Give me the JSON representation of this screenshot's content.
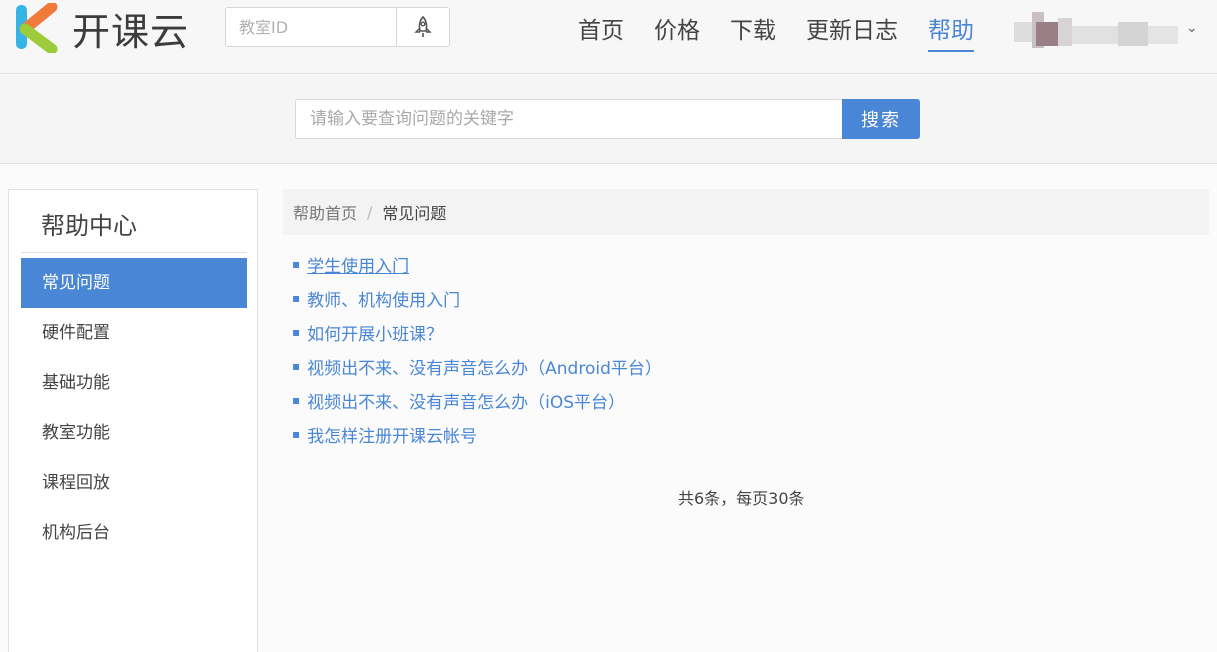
{
  "brand": {
    "name": "开课云",
    "accent": "#4a86d6"
  },
  "header": {
    "room_placeholder": "教室ID",
    "room_button_icon": "rocket-icon",
    "nav": [
      {
        "label": "首页",
        "active": false
      },
      {
        "label": "价格",
        "active": false
      },
      {
        "label": "下载",
        "active": false
      },
      {
        "label": "更新日志",
        "active": false
      },
      {
        "label": "帮助",
        "active": true
      }
    ],
    "user_dropdown_icon": "chevron-down-icon"
  },
  "search": {
    "placeholder": "请输入要查询问题的关键字",
    "button_label": "搜索"
  },
  "sidebar": {
    "title": "帮助中心",
    "items": [
      {
        "label": "常见问题",
        "active": true
      },
      {
        "label": "硬件配置",
        "active": false
      },
      {
        "label": "基础功能",
        "active": false
      },
      {
        "label": "教室功能",
        "active": false
      },
      {
        "label": "课程回放",
        "active": false
      },
      {
        "label": "机构后台",
        "active": false
      }
    ]
  },
  "breadcrumb": {
    "home": "帮助首页",
    "separator": "/",
    "current": "常见问题"
  },
  "faq": [
    {
      "title": "学生使用入门"
    },
    {
      "title": "教师、机构使用入门"
    },
    {
      "title": "如何开展小班课？"
    },
    {
      "title": "视频出不来、没有声音怎么办（Android平台）"
    },
    {
      "title": "视频出不来、没有声音怎么办（iOS平台）"
    },
    {
      "title": "我怎样注册开课云帐号"
    }
  ],
  "pager": {
    "info": "共6条，每页30条"
  }
}
